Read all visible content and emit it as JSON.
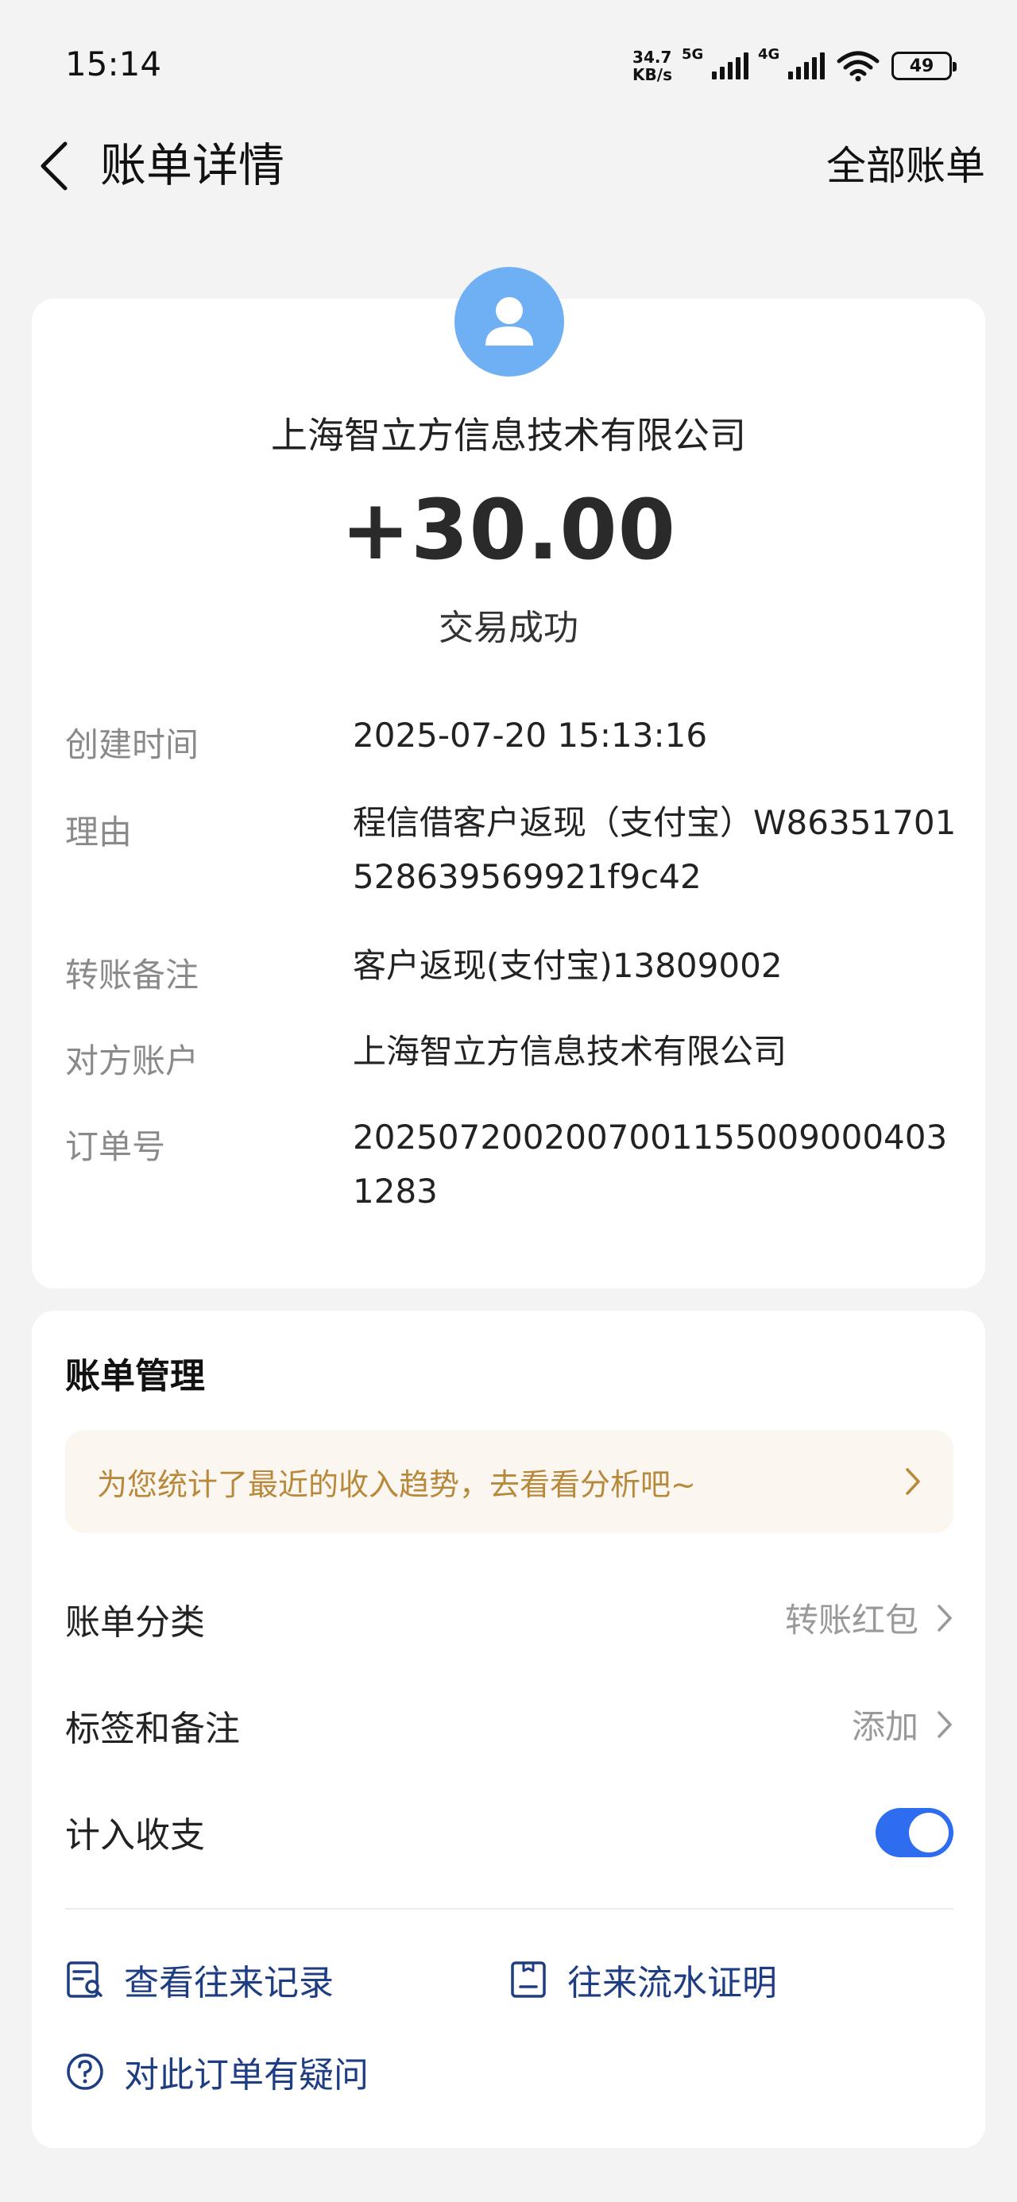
{
  "status_bar": {
    "time": "15:14",
    "net_speed_value": "34.7",
    "net_speed_unit": "KB/s",
    "sim1_label": "5G",
    "sim2_label": "4G",
    "battery": "49"
  },
  "header": {
    "title": "账单详情",
    "action": "全部账单"
  },
  "transaction": {
    "merchant": "上海智立方信息技术有限公司",
    "amount": "+30.00",
    "status": "交易成功",
    "details": [
      {
        "label": "创建时间",
        "value": "2025-07-20 15:13:16"
      },
      {
        "label": "理由",
        "value": "程信借客户返现（支付宝）W86351701528639569921f9c42"
      },
      {
        "label": "转账备注",
        "value": "客户返现(支付宝)13809002"
      },
      {
        "label": "对方账户",
        "value": "上海智立方信息技术有限公司"
      },
      {
        "label": "订单号",
        "value": "20250720020070011550090004031283"
      }
    ]
  },
  "manage": {
    "title": "账单管理",
    "promo": "为您统计了最近的收入趋势，去看看分析吧~",
    "category_label": "账单分类",
    "category_value": "转账红包",
    "tags_label": "标签和备注",
    "tags_value": "添加",
    "include_label": "计入收支",
    "include_on": true,
    "link_records": "查看往来记录",
    "link_proof": "往来流水证明",
    "link_question": "对此订单有疑问"
  },
  "colors": {
    "accent": "#2e6cf0",
    "avatar": "#6fb0f5",
    "promo_text": "#b8893a",
    "link": "#1f3d82"
  }
}
